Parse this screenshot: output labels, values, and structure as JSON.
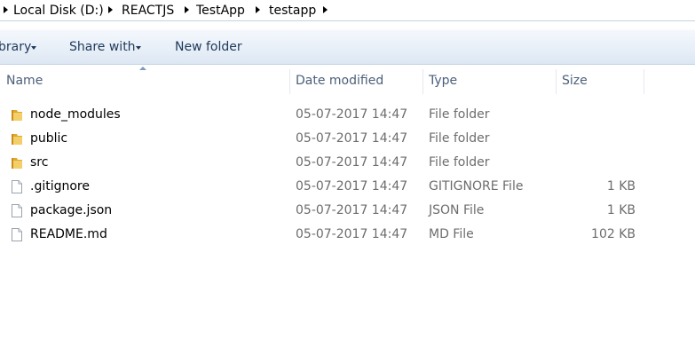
{
  "breadcrumb": {
    "items": [
      "Local Disk (D:)",
      "REACTJS",
      "TestApp",
      "testapp"
    ]
  },
  "toolbar": {
    "library_label": "brary",
    "share_label": "Share with",
    "new_folder_label": "New folder"
  },
  "columns": {
    "name": "Name",
    "date": "Date modified",
    "type": "Type",
    "size": "Size"
  },
  "files": [
    {
      "name": "node_modules",
      "date": "05-07-2017 14:47",
      "type": "File folder",
      "size": "",
      "icon": "folder-icon"
    },
    {
      "name": "public",
      "date": "05-07-2017 14:47",
      "type": "File folder",
      "size": "",
      "icon": "folder-icon"
    },
    {
      "name": "src",
      "date": "05-07-2017 14:47",
      "type": "File folder",
      "size": "",
      "icon": "folder-icon"
    },
    {
      "name": ".gitignore",
      "date": "05-07-2017 14:47",
      "type": "GITIGNORE File",
      "size": "1 KB",
      "icon": "file-icon"
    },
    {
      "name": "package.json",
      "date": "05-07-2017 14:47",
      "type": "JSON File",
      "size": "1 KB",
      "icon": "file-icon"
    },
    {
      "name": "README.md",
      "date": "05-07-2017 14:47",
      "type": "MD File",
      "size": "102 KB",
      "icon": "file-icon"
    }
  ],
  "colors": {
    "toolbar_text": "#1e395b",
    "header_text": "#4c607a",
    "detail_text": "#6d6d6d",
    "folder": "#e8b84a"
  }
}
